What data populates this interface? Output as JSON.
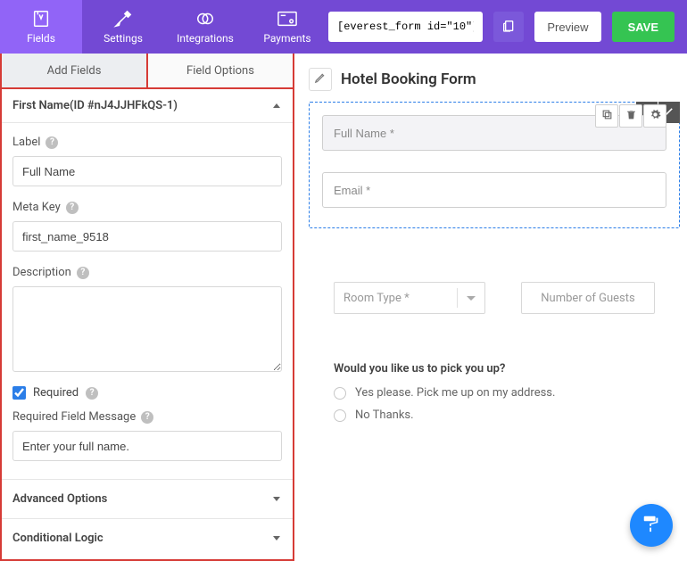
{
  "topbar": {
    "tabs": {
      "fields": "Fields",
      "settings": "Settings",
      "integrations": "Integrations",
      "payments": "Payments"
    },
    "shortcode": "[everest_form id=\"10\"]",
    "preview": "Preview",
    "save": "SAVE"
  },
  "sidebar": {
    "tabs": {
      "add": "Add Fields",
      "options": "Field Options"
    },
    "section_head": "First Name(ID #nJ4JJHFkQS-1)",
    "label": {
      "label": "Label",
      "value": "Full Name"
    },
    "meta": {
      "label": "Meta Key",
      "value": "first_name_9518"
    },
    "description": {
      "label": "Description",
      "value": ""
    },
    "required": {
      "label": "Required",
      "checked": true
    },
    "required_msg": {
      "label": "Required Field Message",
      "value": "Enter your full name."
    },
    "advanced": "Advanced Options",
    "conditional": "Conditional Logic"
  },
  "canvas": {
    "title": "Hotel Booking Form",
    "full_name_ph": "Full Name *",
    "email_ph": "Email *",
    "room_type": "Room Type *",
    "guests": "Number of Guests",
    "question": {
      "title": "Would you like us to pick you up?",
      "opt1": "Yes please. Pick me up on my address.",
      "opt2": "No Thanks."
    }
  }
}
